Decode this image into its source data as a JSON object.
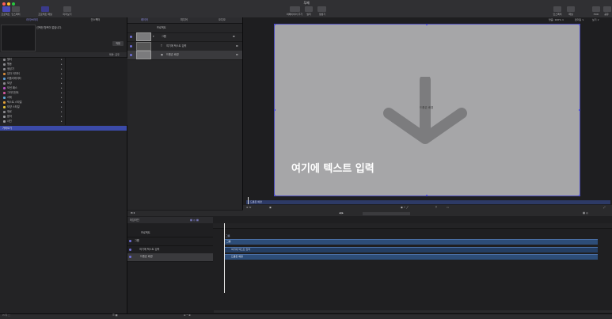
{
  "titlebar": {
    "title": "무제",
    "left_buttons": [
      {
        "label": "프로젝트"
      },
      {
        "label": "인스펙터"
      },
      {
        "label": "프로젝트 패널"
      },
      {
        "label": "미리보기"
      }
    ],
    "center_buttons": [
      {
        "label": "비헤이비어 추가"
      },
      {
        "label": "필터"
      },
      {
        "label": "생성기"
      }
    ],
    "right_buttons": [
      {
        "label": "HUD"
      },
      {
        "label": "공유"
      }
    ],
    "right_pair": [
      {
        "label": "인스펙터"
      },
      {
        "label": "패널"
      }
    ]
  },
  "library": {
    "tabs": [
      "라이브러리",
      "인스펙터"
    ],
    "preview_text": "선택한 항목이 없습니다.",
    "apply_label": "적용",
    "categories_header": "테마: 모두",
    "categories": [
      {
        "label": "필터",
        "color": "#8a8a8e"
      },
      {
        "label": "행동",
        "color": "#8a8a8e"
      },
      {
        "label": "생성기",
        "color": "#8a8a8e"
      },
      {
        "label": "입자 이미터",
        "color": "#d18a3a"
      },
      {
        "label": "리플리케이터",
        "color": "#5a9ad4"
      },
      {
        "label": "모양",
        "color": "#8a8a8e"
      },
      {
        "label": "모션 패스",
        "color": "#b74fc0"
      },
      {
        "label": "그라디언트",
        "color": "#d0579a"
      },
      {
        "label": "서체",
        "color": "#5aa7d4"
      },
      {
        "label": "텍스트 스타일",
        "color": "#e0a038"
      },
      {
        "label": "모양 스타일",
        "color": "#e0c038"
      },
      {
        "label": "재료",
        "color": "#8a8a8e"
      },
      {
        "label": "음악",
        "color": "#9a9a9e"
      },
      {
        "label": "사진",
        "color": "#9a9a9e"
      }
    ],
    "selected_row": "가져오기"
  },
  "layers": {
    "tabs": [
      "레이어",
      "미디어",
      "오디오"
    ],
    "rows": [
      {
        "label": "프로젝트"
      },
      {
        "label": "그룹"
      },
      {
        "label": "여기에 텍스트 입력"
      },
      {
        "label": "드롭존 배경"
      }
    ]
  },
  "canvas": {
    "zoom_text": "맞춤: 100% ∨",
    "view_menu": "렌더링 ∨",
    "options_menu": "보기 ∨",
    "dropzone_label": "드롭존 배경",
    "text": "여기에 텍스트 입력",
    "track_label": "드롭존 배경"
  },
  "timeline": {
    "header": "타임라인",
    "rows": [
      {
        "label": "프로젝트"
      },
      {
        "label": "그룹"
      },
      {
        "label": "여기에 텍스트 입력"
      },
      {
        "label": "드롭존 배경"
      }
    ],
    "bars": [
      {
        "label": "그룹"
      },
      {
        "label": "여기에 텍스트 입력"
      },
      {
        "label": "드롭존 배경"
      }
    ],
    "group_track_label": "그룹",
    "timecode": "00:00:00:00"
  },
  "colors": {
    "accent": "#5a5ad6",
    "selected_row": "#3b4aa8",
    "canvas_bg": "#a6a6a8",
    "bar": "#2d4d78"
  }
}
